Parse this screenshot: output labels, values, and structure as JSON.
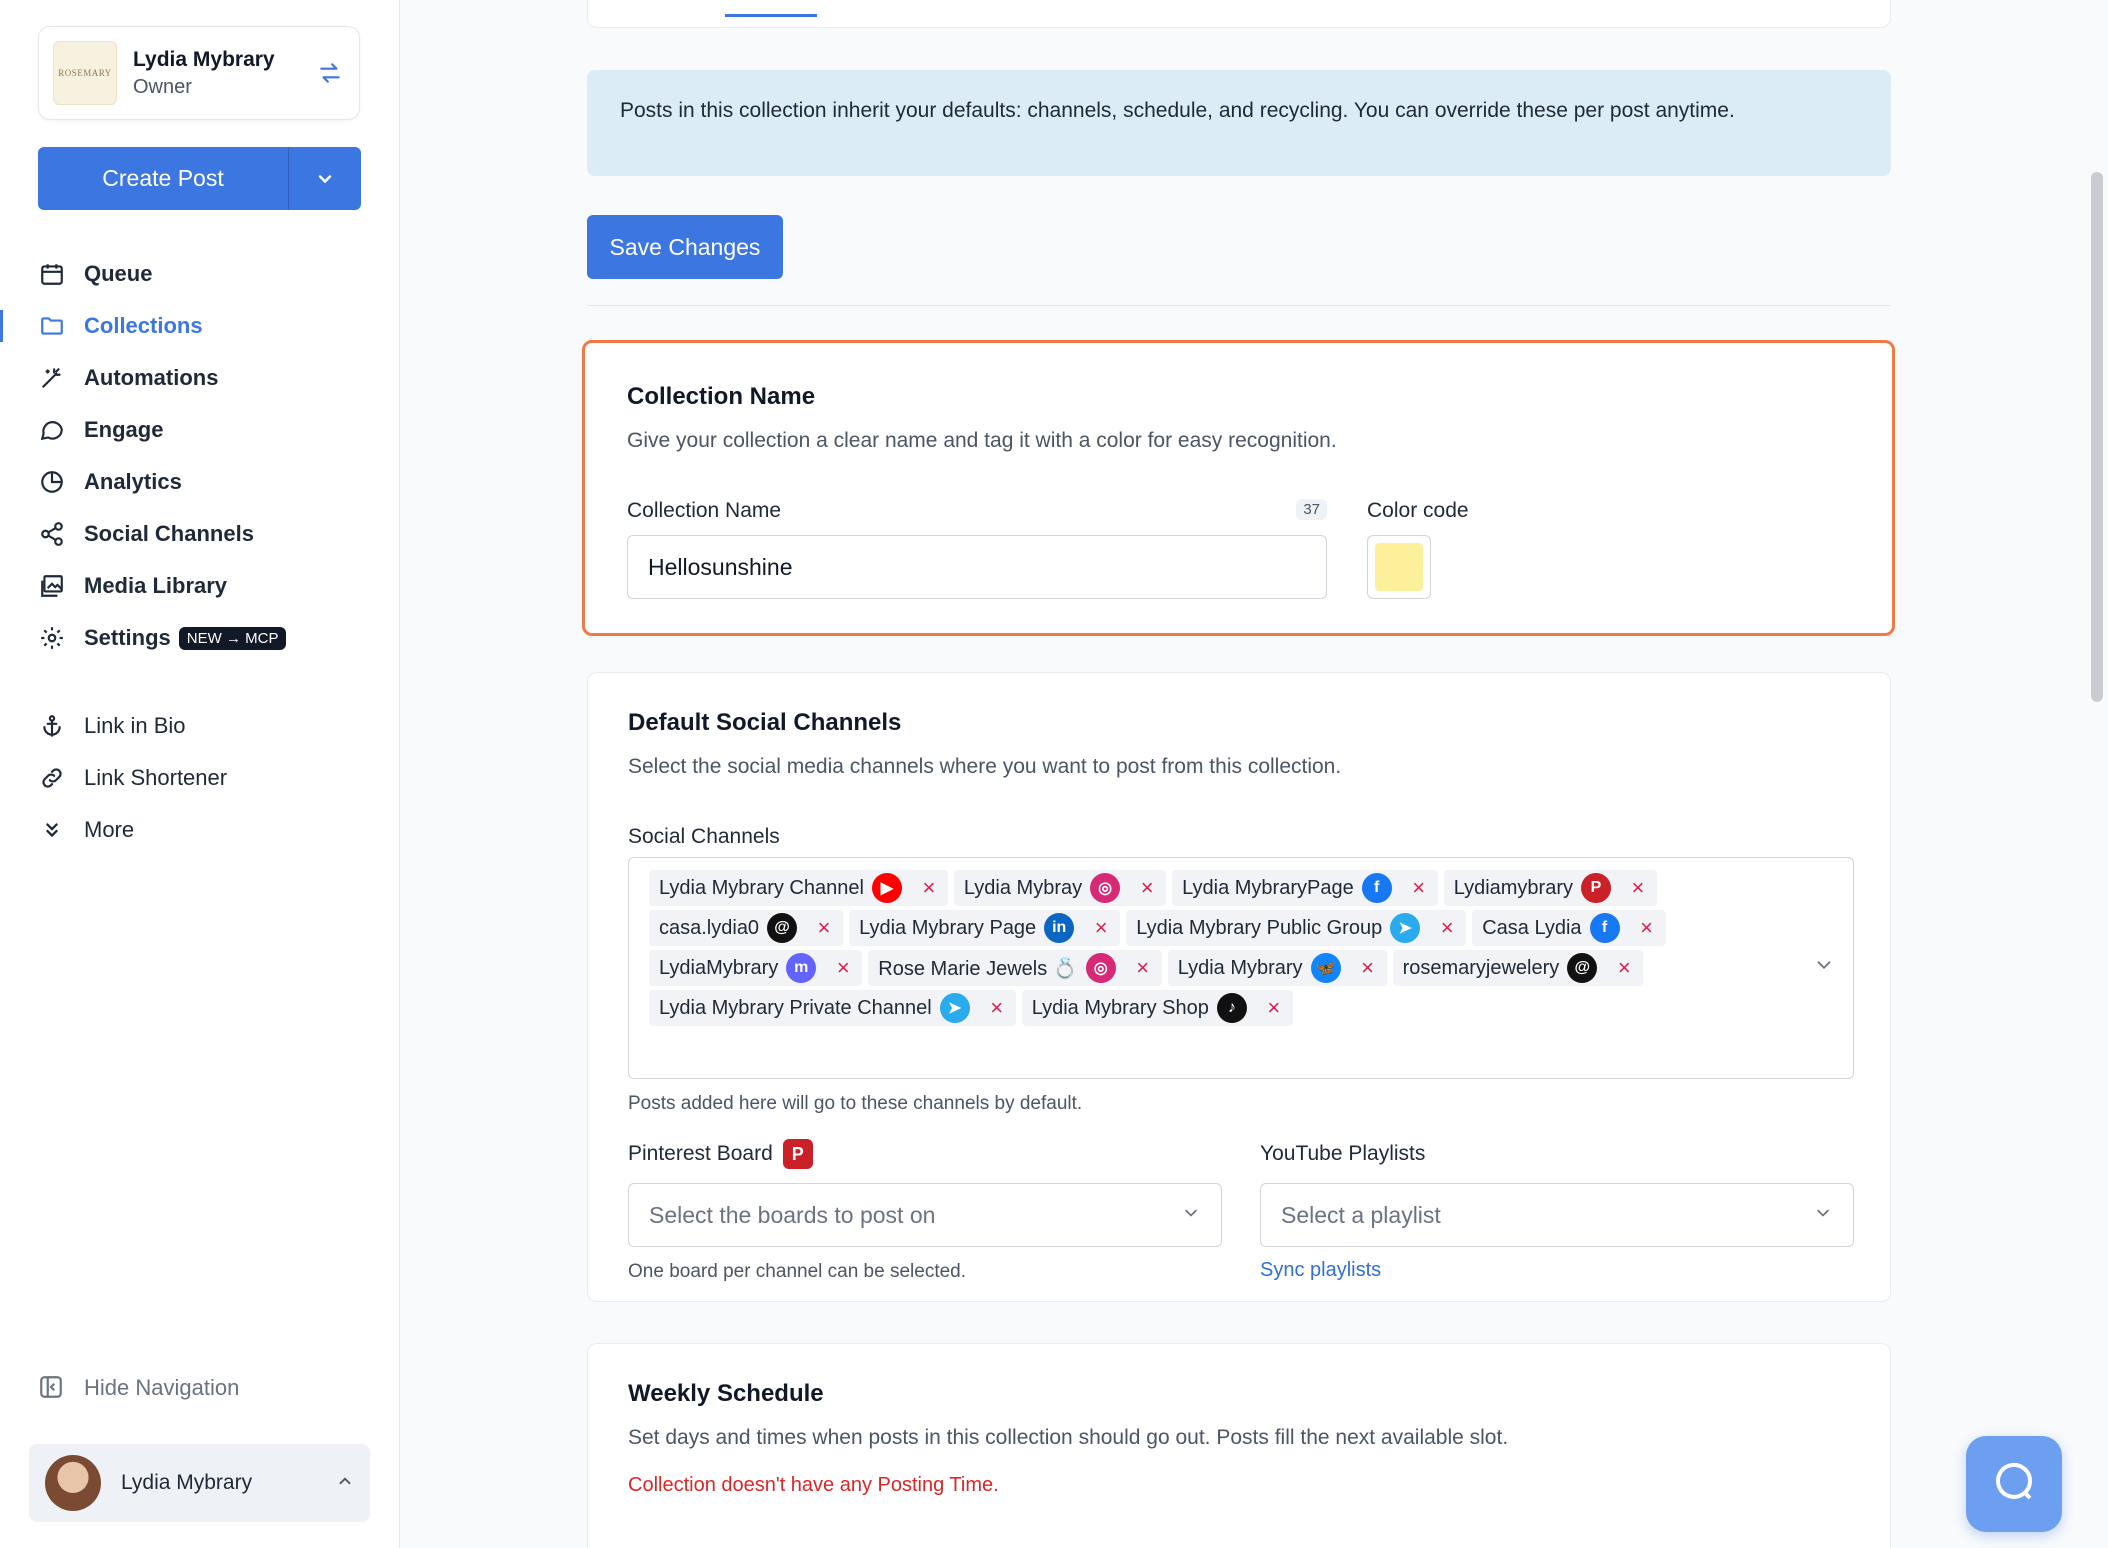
{
  "account": {
    "name": "Lydia Mybrary",
    "role": "Owner",
    "logo_text": "ROSEMARY"
  },
  "create_post": {
    "label": "Create Post"
  },
  "nav": {
    "primary": [
      {
        "label": "Queue",
        "icon": "calendar-icon"
      },
      {
        "label": "Collections",
        "icon": "folder-icon",
        "active": true
      },
      {
        "label": "Automations",
        "icon": "magic-wand-icon"
      },
      {
        "label": "Engage",
        "icon": "chat-bubble-icon"
      },
      {
        "label": "Analytics",
        "icon": "pie-chart-icon"
      },
      {
        "label": "Social Channels",
        "icon": "share-icon"
      },
      {
        "label": "Media Library",
        "icon": "images-icon"
      },
      {
        "label": "Settings",
        "icon": "gear-icon",
        "badge": "NEW → MCP"
      }
    ],
    "secondary": [
      {
        "label": "Link in Bio",
        "icon": "anchor-icon"
      },
      {
        "label": "Link Shortener",
        "icon": "link-icon"
      },
      {
        "label": "More",
        "icon": "double-chevron-down-icon"
      }
    ],
    "hide_navigation": "Hide Navigation"
  },
  "user": {
    "name": "Lydia Mybrary"
  },
  "notice": {
    "text": "Posts in this collection inherit your defaults: channels, schedule, and recycling. You can override these per post anytime."
  },
  "save_button": {
    "label": "Save Changes"
  },
  "collection_name_section": {
    "title": "Collection Name",
    "description": "Give your collection a clear name and tag it with a color for easy recognition.",
    "name_label": "Collection Name",
    "name_value": "Hellosunshine",
    "char_count": "37",
    "color_label": "Color code",
    "color_value": "#fdf09b"
  },
  "channels_section": {
    "title": "Default Social Channels",
    "description": "Select the social media channels where you want to post from this collection.",
    "label": "Social Channels",
    "chips": [
      {
        "name": "Lydia Mybrary Channel",
        "network": "youtube",
        "color": "#ff0000",
        "glyph": "▶"
      },
      {
        "name": "Lydia Mybray",
        "network": "instagram",
        "color": "#d62976",
        "glyph": "◎"
      },
      {
        "name": "Lydia MybraryPage",
        "network": "facebook",
        "color": "#1877f2",
        "glyph": "f"
      },
      {
        "name": "Lydiamybrary",
        "network": "pinterest",
        "color": "#cb2027",
        "glyph": "P"
      },
      {
        "name": "casa.lydia0",
        "network": "threads",
        "color": "#111111",
        "glyph": "@"
      },
      {
        "name": "Lydia Mybrary Page",
        "network": "linkedin",
        "color": "#0a66c2",
        "glyph": "in"
      },
      {
        "name": "Lydia Mybrary Public Group",
        "network": "telegram",
        "color": "#2aabee",
        "glyph": "➤"
      },
      {
        "name": "Casa Lydia",
        "network": "facebook",
        "color": "#1877f2",
        "glyph": "f"
      },
      {
        "name": "LydiaMybrary",
        "network": "mastodon",
        "color": "#6364ff",
        "glyph": "m"
      },
      {
        "name": "Rose Marie Jewels 💍",
        "network": "instagram",
        "color": "#d62976",
        "glyph": "◎"
      },
      {
        "name": "Lydia Mybrary",
        "network": "bluesky",
        "color": "#1185fe",
        "glyph": "🦋"
      },
      {
        "name": "rosemaryjewelery",
        "network": "threads",
        "color": "#111111",
        "glyph": "@"
      },
      {
        "name": "Lydia Mybrary Private Channel",
        "network": "telegram",
        "color": "#2aabee",
        "glyph": "➤"
      },
      {
        "name": "Lydia Mybrary Shop",
        "network": "tiktok",
        "color": "#111111",
        "glyph": "♪"
      }
    ],
    "hint": "Posts added here will go to these channels by default.",
    "pinterest": {
      "label": "Pinterest Board",
      "placeholder": "Select the boards to post on",
      "hint": "One board per channel can be selected."
    },
    "youtube": {
      "label": "YouTube Playlists",
      "placeholder": "Select a playlist",
      "link": "Sync playlists"
    }
  },
  "weekly_section": {
    "title": "Weekly Schedule",
    "description": "Set days and times when posts in this collection should go out. Posts fill the next available slot.",
    "error": "Collection doesn't have any Posting Time."
  },
  "colors": {
    "accent": "#3b76e1",
    "highlight_border": "#f07a46",
    "error": "#dc2626",
    "notice_bg": "#dcecf6"
  }
}
